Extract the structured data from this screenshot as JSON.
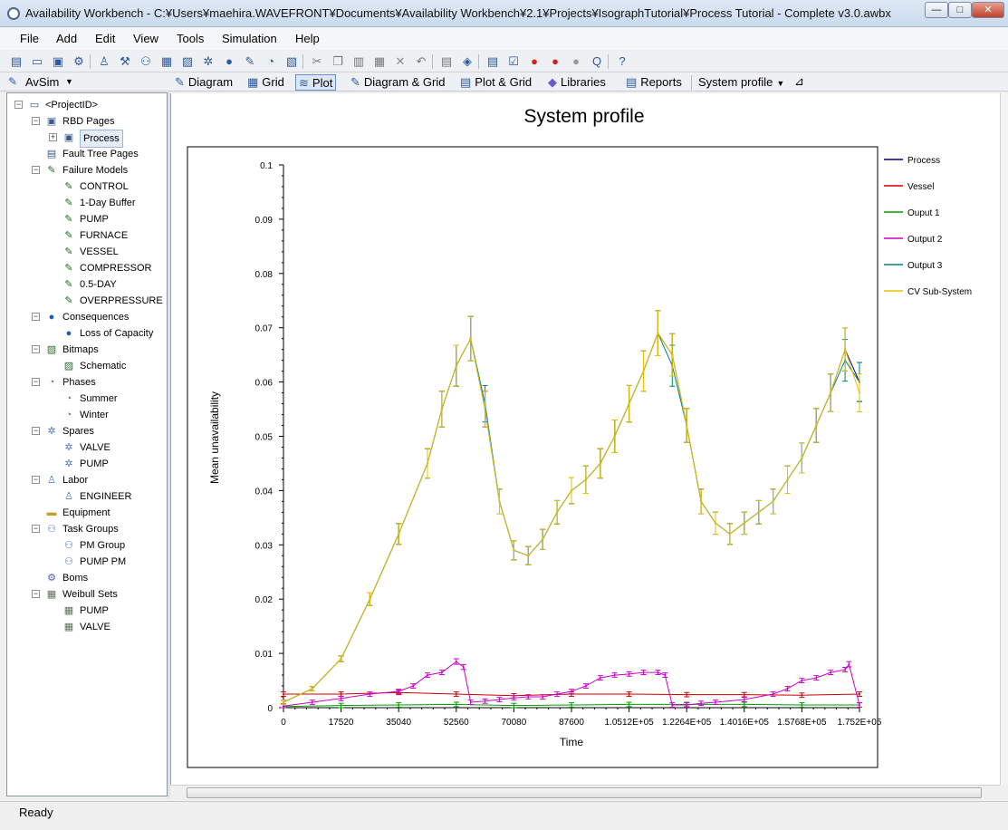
{
  "window": {
    "title": "Availability Workbench - C:¥Users¥maehira.WAVEFRONT¥Documents¥Availability Workbench¥2.1¥Projects¥IsographTutorial¥Process Tutorial - Complete v3.0.awbx",
    "min_glyph": "—",
    "max_glyph": "□",
    "close_glyph": "✕"
  },
  "menu": [
    "File",
    "Add",
    "Edit",
    "View",
    "Tools",
    "Simulation",
    "Help"
  ],
  "toolbar_icons": [
    "new-icon",
    "open-icon",
    "save-icon",
    "settings-icon",
    "person-icon",
    "tools-icon",
    "group-icon",
    "weibull-icon",
    "bitmap-icon",
    "spares-icon",
    "consequence-icon",
    "model-icon",
    "phase-icon",
    "image-icon",
    "cut-icon",
    "copy-icon",
    "paste-icon",
    "paste-special-icon",
    "delete-icon",
    "undo-icon",
    "window-icon",
    "simulate-icon",
    "report-icon",
    "checklist-icon",
    "traffic-light-icon",
    "traffic-light-icon",
    "traffic-light-off-icon",
    "query-icon",
    "help-icon"
  ],
  "avsim": {
    "label": "AvSim"
  },
  "view_tabs": [
    {
      "label": "Diagram",
      "icon": "pencil-icon"
    },
    {
      "label": "Grid",
      "icon": "grid-icon"
    },
    {
      "label": "Plot",
      "icon": "plot-icon",
      "active": true
    },
    {
      "label": "Diagram & Grid",
      "icon": "diagram-grid-icon"
    },
    {
      "label": "Plot & Grid",
      "icon": "plot-grid-icon"
    },
    {
      "label": "Libraries",
      "icon": "libraries-icon"
    },
    {
      "label": "Reports",
      "icon": "reports-icon"
    },
    {
      "label": "System profile",
      "icon": "",
      "dropdown": true
    }
  ],
  "tree": [
    {
      "label": "<ProjectID>",
      "level": 0,
      "exp": "-",
      "icon": "project-icon"
    },
    {
      "label": "RBD Pages",
      "level": 1,
      "exp": "-",
      "icon": "rbd-icon"
    },
    {
      "label": "Process",
      "level": 2,
      "exp": "+",
      "icon": "rbd-page-icon",
      "selected": true
    },
    {
      "label": "Fault Tree Pages",
      "level": 1,
      "exp": "",
      "icon": "fault-tree-icon"
    },
    {
      "label": "Failure Models",
      "level": 1,
      "exp": "-",
      "icon": "failure-model-icon"
    },
    {
      "label": "CONTROL",
      "level": 2,
      "exp": "",
      "icon": "failure-model-icon"
    },
    {
      "label": "1-Day Buffer",
      "level": 2,
      "exp": "",
      "icon": "failure-model-icon"
    },
    {
      "label": "PUMP",
      "level": 2,
      "exp": "",
      "icon": "failure-model-icon"
    },
    {
      "label": "FURNACE",
      "level": 2,
      "exp": "",
      "icon": "failure-model-icon"
    },
    {
      "label": "VESSEL",
      "level": 2,
      "exp": "",
      "icon": "failure-model-icon"
    },
    {
      "label": "COMPRESSOR",
      "level": 2,
      "exp": "",
      "icon": "failure-model-icon"
    },
    {
      "label": "0.5-DAY",
      "level": 2,
      "exp": "",
      "icon": "failure-model-icon"
    },
    {
      "label": "OVERPRESSURE",
      "level": 2,
      "exp": "",
      "icon": "failure-model-icon"
    },
    {
      "label": "Consequences",
      "level": 1,
      "exp": "-",
      "icon": "consequence-icon"
    },
    {
      "label": "Loss of Capacity",
      "level": 2,
      "exp": "",
      "icon": "consequence-icon"
    },
    {
      "label": "Bitmaps",
      "level": 1,
      "exp": "-",
      "icon": "bitmap-icon"
    },
    {
      "label": "Schematic",
      "level": 2,
      "exp": "",
      "icon": "bitmap-icon"
    },
    {
      "label": "Phases",
      "level": 1,
      "exp": "-",
      "icon": "phase-icon"
    },
    {
      "label": "Summer",
      "level": 2,
      "exp": "",
      "icon": "phase-icon"
    },
    {
      "label": "Winter",
      "level": 2,
      "exp": "",
      "icon": "phase-icon"
    },
    {
      "label": "Spares",
      "level": 1,
      "exp": "-",
      "icon": "spares-icon"
    },
    {
      "label": "VALVE",
      "level": 2,
      "exp": "",
      "icon": "spares-icon"
    },
    {
      "label": "PUMP",
      "level": 2,
      "exp": "",
      "icon": "spares-icon"
    },
    {
      "label": "Labor",
      "level": 1,
      "exp": "-",
      "icon": "labor-icon"
    },
    {
      "label": "ENGINEER",
      "level": 2,
      "exp": "",
      "icon": "labor-icon"
    },
    {
      "label": "Equipment",
      "level": 1,
      "exp": "",
      "icon": "equipment-icon"
    },
    {
      "label": "Task Groups",
      "level": 1,
      "exp": "-",
      "icon": "task-group-icon"
    },
    {
      "label": "PM Group",
      "level": 2,
      "exp": "",
      "icon": "task-group-icon"
    },
    {
      "label": "PUMP PM",
      "level": 2,
      "exp": "",
      "icon": "task-group-icon"
    },
    {
      "label": "Boms",
      "level": 1,
      "exp": "",
      "icon": "boms-icon"
    },
    {
      "label": "Weibull Sets",
      "level": 1,
      "exp": "-",
      "icon": "weibull-icon"
    },
    {
      "label": "PUMP",
      "level": 2,
      "exp": "",
      "icon": "weibull-icon"
    },
    {
      "label": "VALVE",
      "level": 2,
      "exp": "",
      "icon": "weibull-icon"
    }
  ],
  "status": {
    "text": "Ready"
  },
  "chart_data": {
    "type": "line",
    "title": "System profile",
    "xlabel": "Time",
    "ylabel": "Mean unavailability",
    "xlim": [
      0,
      175200
    ],
    "ylim": [
      0,
      0.1
    ],
    "x_ticks": [
      "0",
      "17520",
      "35040",
      "52560",
      "70080",
      "87600",
      "1.0512E+05",
      "1.2264E+05",
      "1.4016E+05",
      "1.5768E+05",
      "1.752E+05"
    ],
    "y_ticks": [
      "0",
      "0.01",
      "0.02",
      "0.03",
      "0.04",
      "0.05",
      "0.06",
      "0.07",
      "0.08",
      "0.09",
      "0.1"
    ],
    "legend_position": "right",
    "error_bars": true,
    "series": [
      {
        "name": "Process",
        "color": "#000080",
        "x": [
          0,
          8760,
          17520,
          26280,
          35040,
          43800,
          48180,
          52560,
          56940,
          61320,
          65700,
          70080,
          74460,
          78840,
          83220,
          87600,
          91980,
          96360,
          100740,
          105120,
          109500,
          113880,
          118260,
          122640,
          127020,
          131400,
          135780,
          140160,
          144540,
          148920,
          153300,
          157680,
          162060,
          166440,
          170820,
          175200
        ],
        "y": [
          0.001,
          0.0035,
          0.009,
          0.02,
          0.032,
          0.045,
          0.055,
          0.063,
          0.068,
          0.055,
          0.038,
          0.029,
          0.028,
          0.031,
          0.036,
          0.04,
          0.042,
          0.045,
          0.05,
          0.056,
          0.062,
          0.069,
          0.065,
          0.052,
          0.038,
          0.034,
          0.032,
          0.034,
          0.036,
          0.038,
          0.042,
          0.046,
          0.052,
          0.058,
          0.066,
          0.06
        ]
      },
      {
        "name": "Vessel",
        "color": "#cc0000",
        "x": [
          0,
          17520,
          35040,
          52560,
          70080,
          87600,
          105120,
          122640,
          140160,
          157680,
          175200
        ],
        "y": [
          0.0025,
          0.0025,
          0.0028,
          0.0025,
          0.0022,
          0.0025,
          0.0025,
          0.0024,
          0.0024,
          0.0023,
          0.0025
        ]
      },
      {
        "name": "Ouput 1",
        "color": "#00a000",
        "x": [
          0,
          17520,
          35040,
          52560,
          70080,
          87600,
          105120,
          122640,
          140160,
          157680,
          175200
        ],
        "y": [
          0.0002,
          0.0004,
          0.0005,
          0.0006,
          0.0004,
          0.0005,
          0.0006,
          0.0006,
          0.0006,
          0.0005,
          0.0005
        ]
      },
      {
        "name": "Output 2",
        "color": "#cc00cc",
        "x": [
          0,
          8760,
          17520,
          26280,
          35040,
          39420,
          43800,
          48180,
          52560,
          54750,
          56940,
          61320,
          65700,
          70080,
          74460,
          78840,
          83220,
          87600,
          91980,
          96360,
          100740,
          105120,
          109500,
          113880,
          116070,
          118260,
          122640,
          127020,
          131400,
          140160,
          148920,
          153300,
          157680,
          162060,
          166440,
          170820,
          172000,
          175200
        ],
        "y": [
          0.0003,
          0.001,
          0.0017,
          0.0025,
          0.003,
          0.004,
          0.006,
          0.0065,
          0.0085,
          0.0075,
          0.001,
          0.0012,
          0.0015,
          0.0018,
          0.002,
          0.002,
          0.0025,
          0.003,
          0.004,
          0.0055,
          0.006,
          0.0062,
          0.0065,
          0.0065,
          0.006,
          0.0005,
          0.0005,
          0.0008,
          0.001,
          0.0015,
          0.0025,
          0.0035,
          0.005,
          0.0055,
          0.0065,
          0.007,
          0.008,
          0.0005
        ]
      },
      {
        "name": "Output 3",
        "color": "#008080",
        "x": [
          0,
          8760,
          17520,
          26280,
          35040,
          43800,
          48180,
          52560,
          56940,
          61320,
          65700,
          70080,
          74460,
          78840,
          83220,
          87600,
          91980,
          96360,
          100740,
          105120,
          109500,
          113880,
          118260,
          122640,
          127020,
          131400,
          135780,
          140160,
          144540,
          148920,
          153300,
          157680,
          162060,
          166440,
          170820,
          175200
        ],
        "y": [
          0.001,
          0.0035,
          0.009,
          0.02,
          0.032,
          0.045,
          0.055,
          0.063,
          0.068,
          0.056,
          0.038,
          0.029,
          0.028,
          0.031,
          0.036,
          0.04,
          0.042,
          0.045,
          0.05,
          0.056,
          0.062,
          0.069,
          0.063,
          0.052,
          0.038,
          0.034,
          0.032,
          0.034,
          0.036,
          0.038,
          0.042,
          0.046,
          0.052,
          0.058,
          0.064,
          0.06
        ]
      },
      {
        "name": "CV Sub-System",
        "color": "#e8c000",
        "x": [
          0,
          8760,
          17520,
          26280,
          35040,
          43800,
          48180,
          52560,
          56940,
          61320,
          65700,
          70080,
          74460,
          78840,
          83220,
          87600,
          91980,
          96360,
          100740,
          105120,
          109500,
          113880,
          118260,
          122640,
          127020,
          131400,
          135780,
          140160,
          144540,
          148920,
          153300,
          157680,
          162060,
          166440,
          170820,
          175200
        ],
        "y": [
          0.001,
          0.0035,
          0.009,
          0.02,
          0.032,
          0.045,
          0.055,
          0.063,
          0.068,
          0.055,
          0.038,
          0.029,
          0.028,
          0.031,
          0.036,
          0.04,
          0.042,
          0.045,
          0.05,
          0.056,
          0.062,
          0.069,
          0.065,
          0.052,
          0.038,
          0.034,
          0.032,
          0.034,
          0.036,
          0.038,
          0.042,
          0.046,
          0.052,
          0.058,
          0.066,
          0.058
        ]
      }
    ]
  }
}
